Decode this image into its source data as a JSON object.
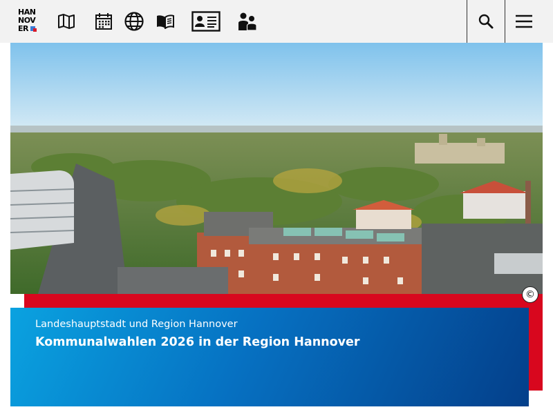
{
  "header": {
    "logo": {
      "line1": "HAN",
      "line2": "NOV",
      "line3": "ER"
    },
    "nav_icons": [
      "map-icon",
      "calendar-icon",
      "globe-icon",
      "open-book-icon",
      "id-card-icon",
      "people-icon"
    ],
    "search_icon": "search-icon",
    "menu_icon": "hamburger-menu-icon"
  },
  "hero": {
    "image_subject": "aerial-city-park-view",
    "copyright_symbol": "©"
  },
  "teaser": {
    "subtitle": "Landeshauptstadt und Region Hannover",
    "title": "Kommunalwahlen 2026 in der Region Hannover"
  },
  "colors": {
    "topbar_bg": "#f2f2f2",
    "accent_red": "#d8071e",
    "teaser_blue_light": "#0aa2e0",
    "teaser_blue_dark": "#043f8a"
  }
}
